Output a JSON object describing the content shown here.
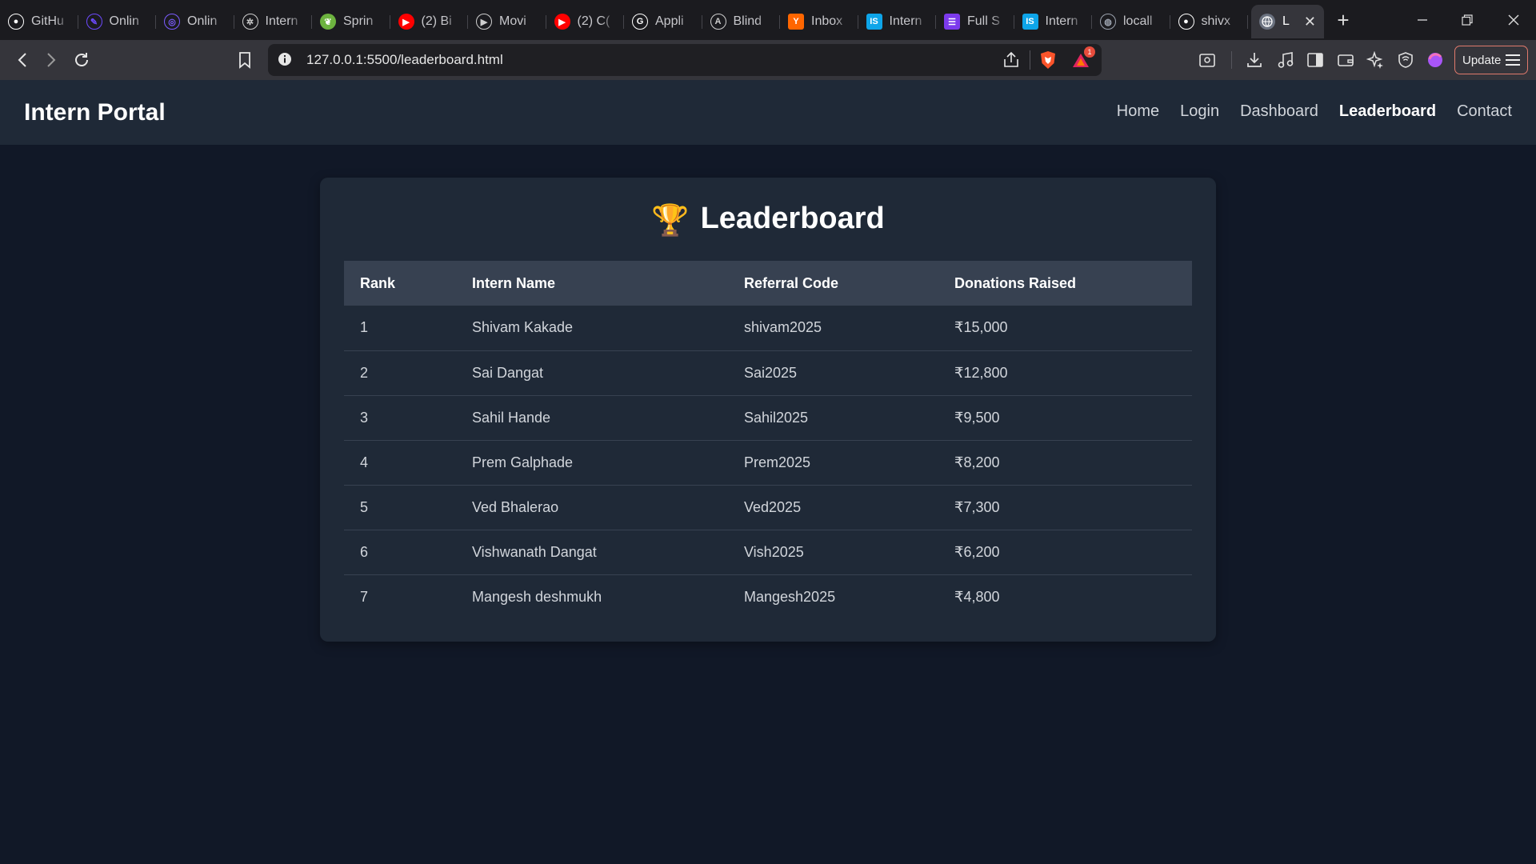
{
  "browser": {
    "tabs": [
      {
        "label": "GitHu",
        "icon": "github-icon",
        "color": "#ffffff"
      },
      {
        "label": "Onlin",
        "icon": "pen-icon",
        "color": "#6d4aff"
      },
      {
        "label": "Onlin",
        "icon": "compass-icon",
        "color": "#7b5cff"
      },
      {
        "label": "Intern",
        "icon": "openai-icon",
        "color": "#cfcfcf"
      },
      {
        "label": "Sprin",
        "icon": "spring-icon",
        "color": "#6db33f"
      },
      {
        "label": "(2) Bi",
        "icon": "youtube-icon",
        "color": "#ff0000"
      },
      {
        "label": "Movi",
        "icon": "play-icon",
        "color": "#cfcfcf"
      },
      {
        "label": "(2) C(",
        "icon": "youtube-icon",
        "color": "#ff0000"
      },
      {
        "label": "Appli",
        "icon": "google-icon",
        "color": "#ffffff"
      },
      {
        "label": "Blind",
        "icon": "blind-icon",
        "color": "#cfcfcf"
      },
      {
        "label": "Inbox",
        "icon": "ycombinator-icon",
        "color": "#ff6600"
      },
      {
        "label": "Intern",
        "icon": "internshala-icon",
        "color": "#0ea5e9"
      },
      {
        "label": "Full S",
        "icon": "list-icon",
        "color": "#7c3aed"
      },
      {
        "label": "Intern",
        "icon": "internshala-icon",
        "color": "#0ea5e9"
      },
      {
        "label": "locall",
        "icon": "globe-icon",
        "color": "#9ca3af"
      },
      {
        "label": "shivx",
        "icon": "github-icon",
        "color": "#ffffff"
      }
    ],
    "active_tab": {
      "label": "L",
      "icon": "globe-icon"
    },
    "url": "127.0.0.1:5500/leaderboard.html",
    "update_label": "Update",
    "notification_count": "1"
  },
  "site": {
    "brand": "Intern Portal",
    "nav": [
      {
        "label": "Home",
        "active": false
      },
      {
        "label": "Login",
        "active": false
      },
      {
        "label": "Dashboard",
        "active": false
      },
      {
        "label": "Leaderboard",
        "active": true
      },
      {
        "label": "Contact",
        "active": false
      }
    ]
  },
  "leaderboard": {
    "trophy": "🏆",
    "title": "Leaderboard",
    "columns": [
      "Rank",
      "Intern Name",
      "Referral Code",
      "Donations Raised"
    ],
    "rows": [
      {
        "rank": "1",
        "name": "Shivam Kakade",
        "code": "shivam2025",
        "amount": "₹15,000"
      },
      {
        "rank": "2",
        "name": "Sai Dangat",
        "code": "Sai2025",
        "amount": "₹12,800"
      },
      {
        "rank": "3",
        "name": "Sahil Hande",
        "code": "Sahil2025",
        "amount": "₹9,500"
      },
      {
        "rank": "4",
        "name": "Prem Galphade",
        "code": "Prem2025",
        "amount": "₹8,200"
      },
      {
        "rank": "5",
        "name": "Ved Bhalerao",
        "code": "Ved2025",
        "amount": "₹7,300"
      },
      {
        "rank": "6",
        "name": "Vishwanath Dangat",
        "code": "Vish2025",
        "amount": "₹6,200"
      },
      {
        "rank": "7",
        "name": "Mangesh deshmukh",
        "code": "Mangesh2025",
        "amount": "₹4,800"
      }
    ]
  }
}
